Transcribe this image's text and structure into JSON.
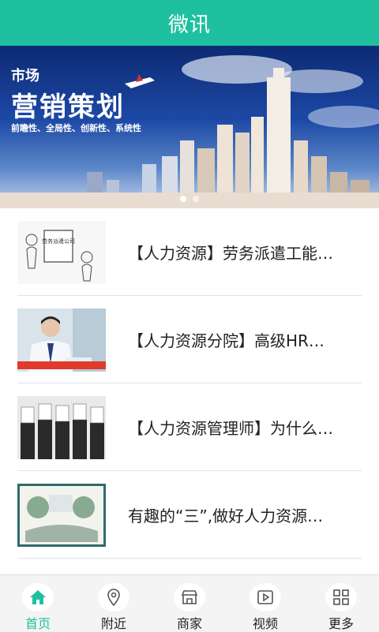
{
  "header": {
    "title": "微讯"
  },
  "banner": {
    "line1": "市场",
    "line2": "营销策划",
    "line3": "前瞻性、全局性、创新性、系统性",
    "dots": 2,
    "active_dot": 0
  },
  "articles": [
    {
      "title": "【人力资源】劳务派遣工能…",
      "thumb_label": "劳务派遣公司"
    },
    {
      "title": "【人力资源分院】高级HR…"
    },
    {
      "title": "【人力资源管理师】为什么…"
    },
    {
      "title": "有趣的“三”,做好人力资源…"
    }
  ],
  "tabbar": {
    "items": [
      {
        "label": "首页",
        "icon": "home-icon",
        "active": true
      },
      {
        "label": "附近",
        "icon": "location-icon",
        "active": false
      },
      {
        "label": "商家",
        "icon": "store-icon",
        "active": false
      },
      {
        "label": "视频",
        "icon": "video-icon",
        "active": false
      },
      {
        "label": "更多",
        "icon": "grid-icon",
        "active": false
      }
    ]
  },
  "colors": {
    "accent": "#1ec0a0"
  }
}
